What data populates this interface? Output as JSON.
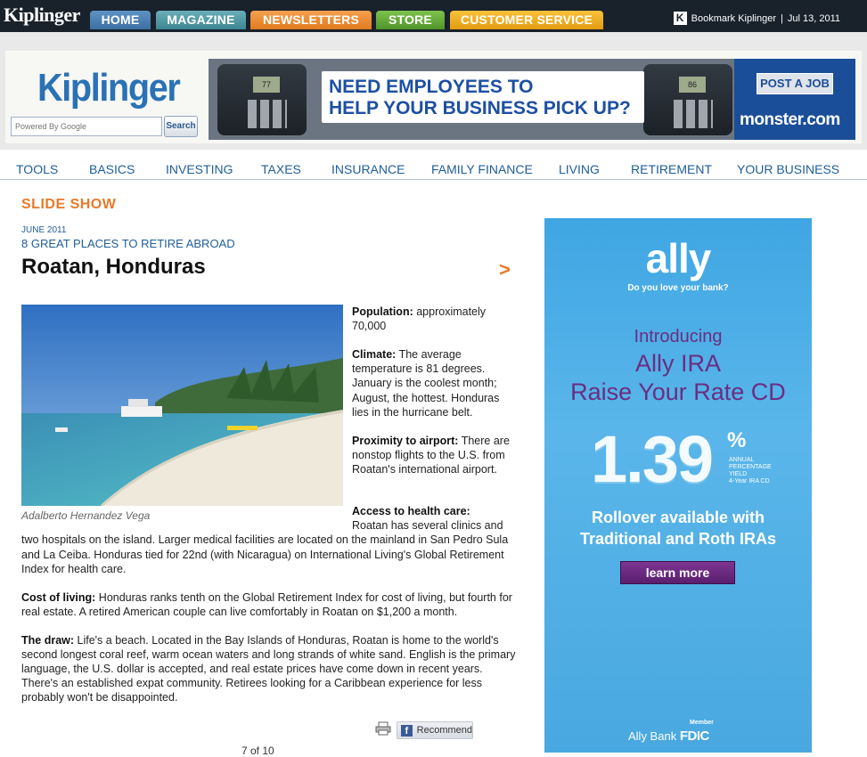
{
  "topbar": {
    "logo": "Kiplinger",
    "tabs": {
      "home": "HOME",
      "magazine": "MAGAZINE",
      "newsletters": "NEWSLETTERS",
      "store": "STORE",
      "customer_service": "CUSTOMER SERVICE"
    },
    "bookmark_icon_letter": "K",
    "bookmark": "Bookmark Kiplinger",
    "separator": "|",
    "date": "Jul 13, 2011"
  },
  "header": {
    "logo": "Kiplinger",
    "search_placeholder": "Powered By Google",
    "search_button": "Search"
  },
  "banner_ad": {
    "headline_line1": "NEED EMPLOYEES TO",
    "headline_line2": "HELP YOUR BUSINESS PICK UP?",
    "phone_display_1": "77",
    "phone_display_2": "86",
    "cta": "POST A JOB",
    "brand": "monster.com"
  },
  "nav": {
    "items": [
      "TOOLS",
      "BASICS",
      "INVESTING",
      "TAXES",
      "INSURANCE",
      "FAMILY FINANCE",
      "LIVING",
      "RETIREMENT",
      "YOUR BUSINESS"
    ]
  },
  "article": {
    "section_label": "SLIDE SHOW",
    "date": "JUNE 2011",
    "series": "8 GREAT PLACES TO RETIRE ABROAD",
    "title": "Roatan, Honduras",
    "next_arrow": ">",
    "photo_caption": "Adalberto Hernandez Vega",
    "population_label": "Population:",
    "population_text": " approximately 70,000",
    "climate_label": "Climate:",
    "climate_text": " The average temperature is 81 degrees. January is the coolest month; August, the hottest. Honduras lies in the hurricane belt.",
    "airport_label": "Proximity to airport:",
    "airport_text": " There are nonstop flights to the U.S. from Roatan's international airport.",
    "health_label": "Access to health care:",
    "health_text": "Roatan has several clinics and two hospitals on the island. Larger medical facilities are located on the mainland in San Pedro Sula and La Ceiba. Honduras tied for 22nd (with Nicaragua) on International Living's Global Retirement Index for health care.",
    "cost_label": "Cost of living:",
    "cost_text": " Honduras ranks tenth on the Global Retirement Index for cost of living, but fourth for real estate. A retired American couple can live comfortably in Roatan on $1,200 a month.",
    "draw_label": "The draw:",
    "draw_text": " Life's a beach. Located in the Bay Islands of Honduras, Roatan is home to the world's second longest coral reef, warm ocean waters and long strands of white sand. English is the primary language, the U.S. dollar is accepted, and real estate prices have come down in recent years. There's an established expat community. Retirees looking for a Caribbean experience for less probably won't be disappointed.",
    "recommend_icon_letter": "f",
    "recommend": "Recommend",
    "pager": "7 of 10"
  },
  "side_ad": {
    "logo": "ally",
    "tagline": "Do you love your bank?",
    "intro": "Introducing",
    "line1": "Ally IRA",
    "line2": "Raise Your Rate CD",
    "rate": "1.39",
    "percent": "%",
    "apy_line1": "ANNUAL",
    "apy_line2": "PERCENTAGE",
    "apy_line3": "YIELD",
    "apy_line4": "4-Year IRA CD",
    "rollover_line1": "Rollover available with",
    "rollover_line2": "Traditional and Roth IRAs",
    "cta": "learn more",
    "member": "Member",
    "bank": "Ally Bank",
    "fdic": "FDIC"
  },
  "colors": {
    "brand_blue": "#2a72b5",
    "accent_orange": "#e8792a",
    "nav_blue": "#1f5d99",
    "ally_purple": "#6a2e82"
  }
}
